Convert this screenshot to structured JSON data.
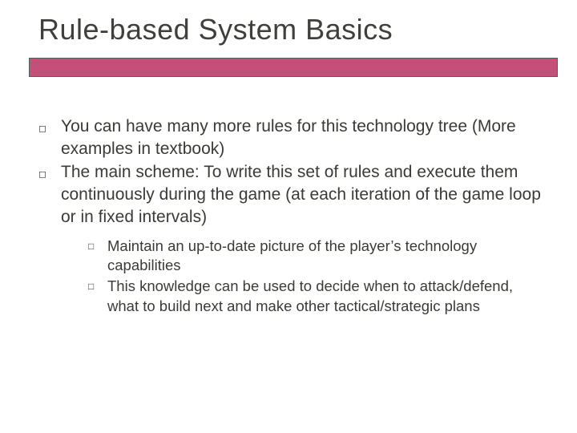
{
  "title": "Rule-based System Basics",
  "bullets": {
    "b0": "You can have many more rules for this technology tree (More examples in textbook)",
    "b1": "The main scheme: To write this set of rules and execute them continuously during the game (at each iteration of the game loop or in fixed intervals)",
    "b1_sub": {
      "s0": "Maintain an up-to-date picture of the player’s technology capabilities",
      "s1": "This knowledge can be used to decide when to attack/defend, what to build next and make other tactical/strategic plans"
    }
  }
}
